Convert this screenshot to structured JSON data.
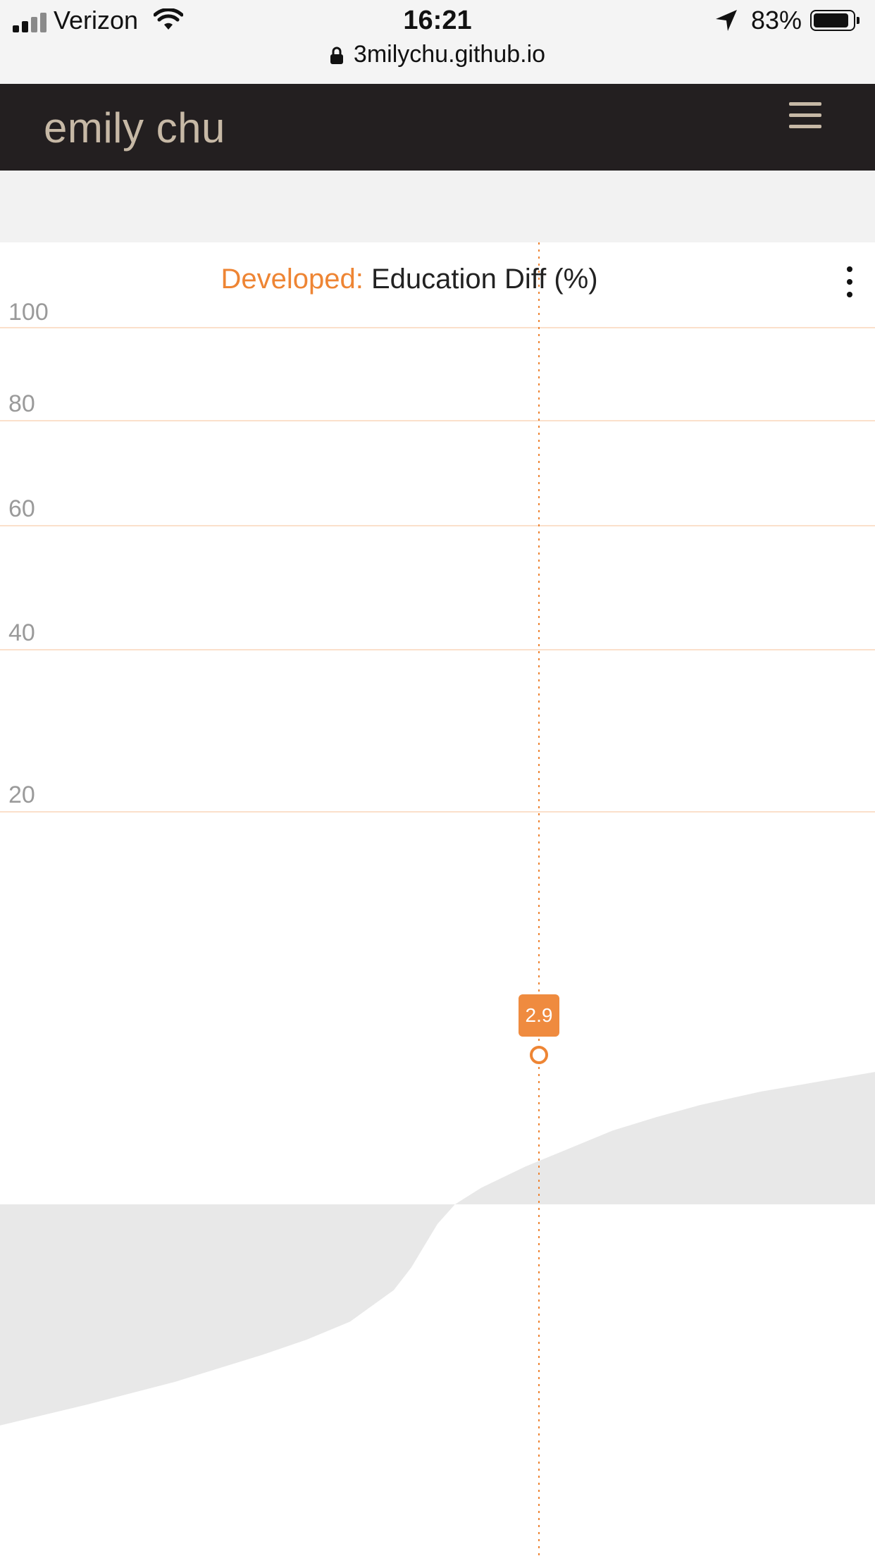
{
  "status_bar": {
    "carrier": "Verizon",
    "time": "16:21",
    "battery": "83%",
    "battery_level": 0.83,
    "url": "3milychu.github.io"
  },
  "header": {
    "brand": "emily chu",
    "menu_icon": "hamburger-menu-icon"
  },
  "chart_data": {
    "type": "area",
    "title_prefix": "Developed:",
    "title": "Education Diff (%)",
    "y_ticks": [
      "100",
      "80",
      "60",
      "40",
      "20"
    ],
    "ylim": [
      -15,
      104
    ],
    "grid": true,
    "selected_label": "2.9",
    "series": [
      {
        "x": [
          0,
          0.1,
          0.2,
          0.3,
          0.35,
          0.4,
          0.45,
          0.47,
          0.5,
          0.52,
          0.55,
          0.6,
          0.65,
          0.7,
          0.75,
          0.8,
          0.87,
          0.94,
          1.0
        ],
        "values": [
          -14.7,
          -13.3,
          -11.8,
          -10.0,
          -9.0,
          -7.8,
          -5.7,
          -4.2,
          -1.3,
          0.0,
          1.1,
          2.5,
          3.7,
          4.9,
          5.8,
          6.6,
          7.5,
          8.2,
          8.8
        ]
      }
    ],
    "colors": {
      "accent": "#ee8534",
      "area": "#e8e8e8",
      "grid": "#fbe0cb",
      "tooltip": "#ef8b3f"
    }
  }
}
